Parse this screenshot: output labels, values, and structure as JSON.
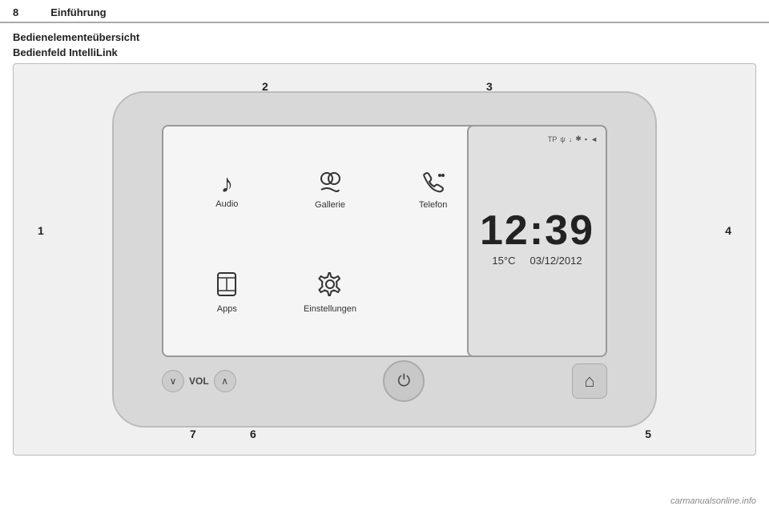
{
  "header": {
    "page_number": "8",
    "title": "Einführung"
  },
  "section": {
    "main_title": "Bedienelementeübersicht",
    "sub_title": "Bedienfeld IntelliLink"
  },
  "screen": {
    "apps": [
      {
        "id": "audio",
        "label": "Audio",
        "icon": "♪"
      },
      {
        "id": "gallery",
        "label": "Gallerie",
        "icon": "👤"
      },
      {
        "id": "phone",
        "label": "Telefon",
        "icon": "📞"
      },
      {
        "id": "apps",
        "label": "Apps",
        "icon": "📱"
      },
      {
        "id": "settings",
        "label": "Einstellungen",
        "icon": "⚙"
      }
    ],
    "status_bar": {
      "tp": "TP",
      "icons": [
        "ψ",
        "↓",
        "✱",
        "▪",
        "◄"
      ]
    },
    "time": "12:39",
    "temp": "15°C",
    "date": "03/12/2012"
  },
  "controls": {
    "vol_label": "VOL",
    "vol_down": "∨",
    "vol_up": "∧",
    "power_icon": "⏻",
    "home_icon": "⌂"
  },
  "callouts": {
    "1": "1",
    "2": "2",
    "3": "3",
    "4": "4",
    "5": "5",
    "6": "6",
    "7": "7"
  },
  "watermark": "carmanualsonline.info"
}
